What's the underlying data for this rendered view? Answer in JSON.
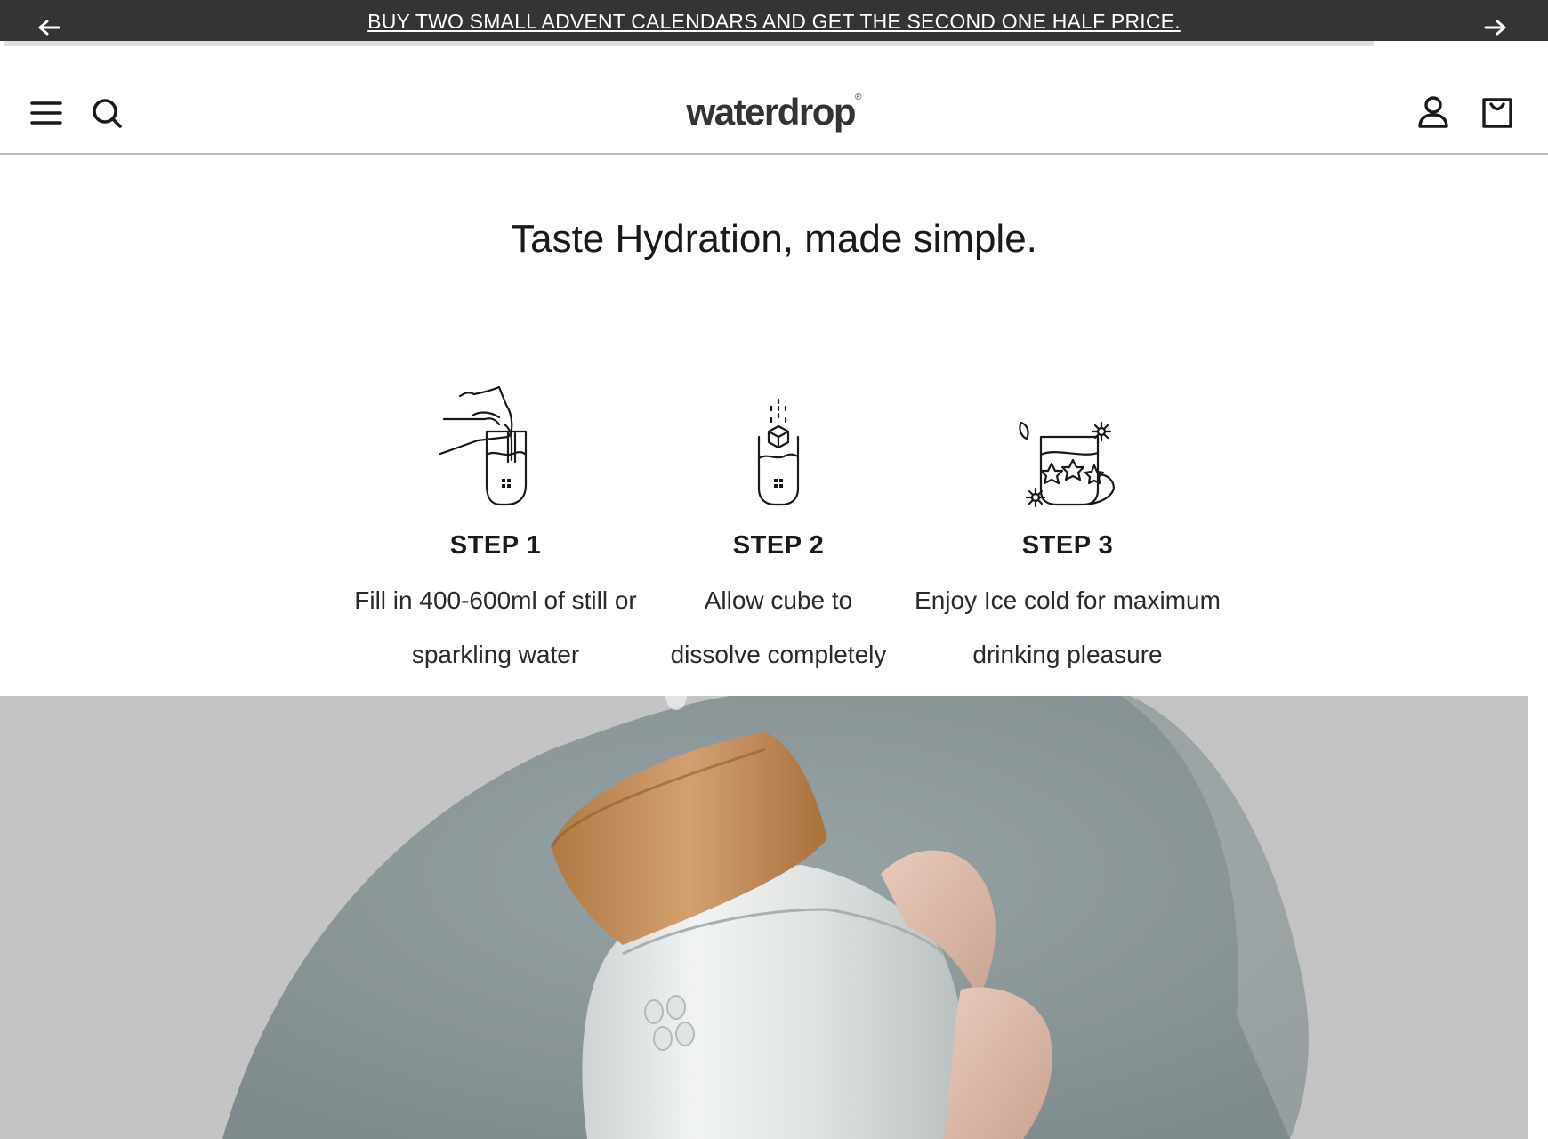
{
  "promo": {
    "text": "BUY TWO SMALL ADVENT CALENDARS AND GET THE SECOND ONE HALF PRICE.",
    "prev_icon": "arrow-left-icon",
    "next_icon": "arrow-right-icon",
    "background": "#333435"
  },
  "header": {
    "logo": "waterdrop",
    "logo_mark": "®",
    "icons": [
      "menu-icon",
      "search-icon",
      "account-icon",
      "cart-icon"
    ]
  },
  "main": {
    "title": "Taste Hydration, made simple.",
    "steps": [
      {
        "label": "STEP 1",
        "line1": "Fill in 400-600ml of still or",
        "line2": "sparkling water",
        "icon": "pouring-water-icon"
      },
      {
        "label": "STEP 2",
        "line1": "Allow cube to",
        "line2": "dissolve completely",
        "icon": "cube-dissolve-icon"
      },
      {
        "label": "STEP 3",
        "line1": "Enjoy Ice cold for maximum",
        "line2": "drinking pleasure",
        "icon": "drink-enjoy-icon"
      }
    ]
  },
  "hero": {
    "image": "person holding glass bottle with bamboo cap",
    "background": "#c4c4c4"
  }
}
